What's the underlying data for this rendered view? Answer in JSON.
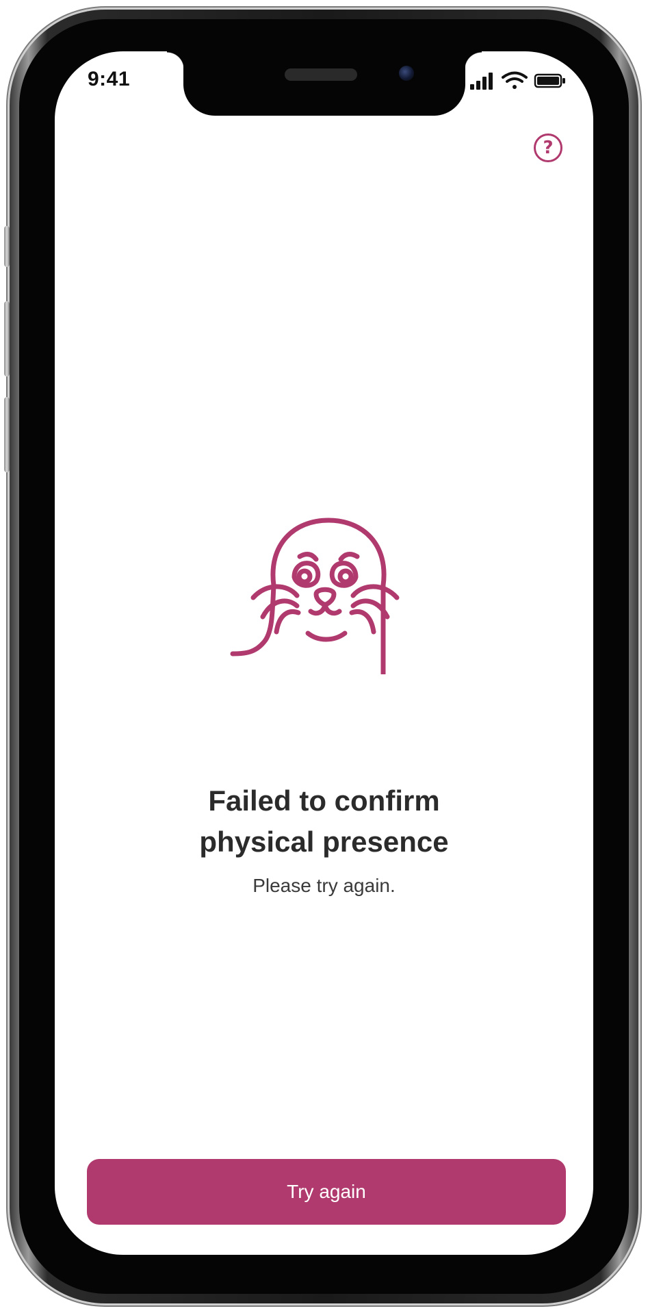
{
  "status_bar": {
    "time": "9:41",
    "icons": [
      "signal-icon",
      "wifi-icon",
      "battery-icon"
    ]
  },
  "header": {
    "help_icon": "question-circle-icon",
    "help_glyph": "?"
  },
  "illustration": {
    "name": "sad-seal-illustration",
    "color": "#b03a6e"
  },
  "message": {
    "title_line1": "Failed to confirm",
    "title_line2": "physical presence",
    "subtitle": "Please try again."
  },
  "actions": {
    "primary_label": "Try again"
  },
  "colors": {
    "accent": "#b03a6e",
    "text_primary": "#2b2b2b",
    "text_secondary": "#3a3a3a",
    "background": "#ffffff"
  }
}
